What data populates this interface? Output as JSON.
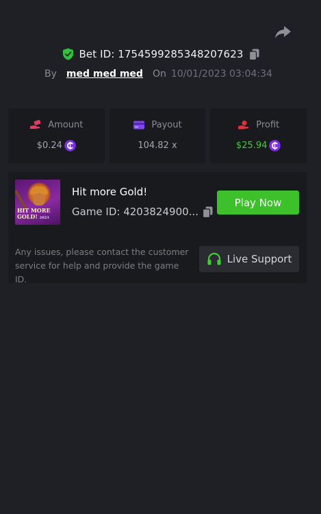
{
  "header": {
    "share_icon": "share-arrow-icon",
    "verified_icon": "shield-check-icon",
    "bet_id_text": "Bet ID: 1754599285348207623",
    "copy_icon": "copy-icon",
    "by_label": "By",
    "username": "med med med",
    "on_label": "On",
    "datetime": "10/01/2023 03:04:34"
  },
  "stats": [
    {
      "icon": "hand-coins-icon",
      "label": "Amount",
      "value": "$0.24",
      "currency_icon": "coin-icon",
      "value_color": "#a5a7ae"
    },
    {
      "icon": "card-icon",
      "label": "Payout",
      "value": "104.82 x",
      "value_color": "#a5a7ae"
    },
    {
      "icon": "hand-profit-icon",
      "label": "Profit",
      "value": "$25.94",
      "currency_icon": "coin-icon",
      "value_color": "#3cd12c"
    }
  ],
  "game": {
    "thumbnail_text": "HIT MORE GOLD!",
    "thumbnail_subtext": "2023",
    "title": "Hit more Gold!",
    "game_id_text": "Game ID: 4203824900...",
    "play_button_label": "Play Now"
  },
  "support": {
    "message": "Any issues, please contact the customer service for help and provide the game ID.",
    "button_label": "Live Support",
    "icon": "headset-icon"
  },
  "colors": {
    "background": "#1f2025",
    "panel": "#181a1e",
    "accent_green": "#3cc12a",
    "profit_green": "#3cd12c",
    "coin_purple": "#7b2cf0"
  }
}
